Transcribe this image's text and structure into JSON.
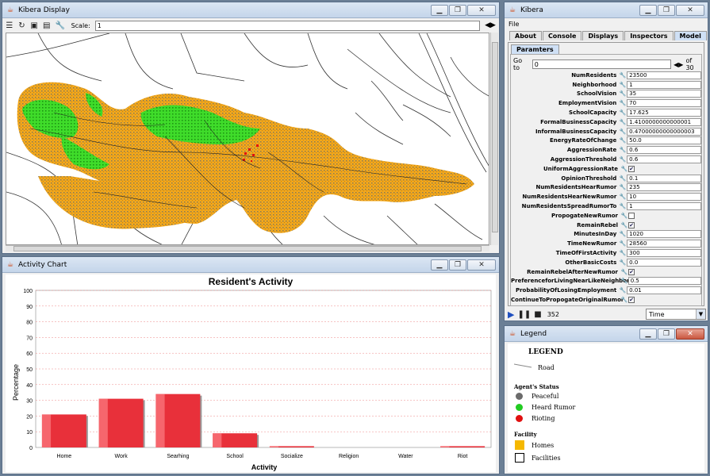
{
  "display_window": {
    "title": "Kibera Display",
    "scale_label": "Scale:",
    "scale_value": "1"
  },
  "chart_window": {
    "title": "Activity Chart"
  },
  "chart_data": {
    "type": "bar",
    "title": "Resident's Activity",
    "xlabel": "Activity",
    "ylabel": "Percentage",
    "categories": [
      "Home",
      "Work",
      "Searhing",
      "School",
      "Socialize",
      "Religion",
      "Water",
      "Riot"
    ],
    "values": [
      21,
      31,
      34,
      9,
      0.8,
      0,
      0,
      0.8
    ],
    "ylim": [
      0,
      100
    ],
    "yticks": [
      "0",
      "10",
      "20",
      "30",
      "40",
      "50",
      "60",
      "70",
      "80",
      "90",
      "100"
    ],
    "grid": true,
    "bar_color": "#e8303a"
  },
  "kibera_window": {
    "title": "Kibera",
    "menu_file": "File",
    "tabs": [
      "About",
      "Console",
      "Displays",
      "Inspectors",
      "Model"
    ],
    "active_tab": "Model",
    "subtab": "Paramters",
    "goto_label": "Go to",
    "goto_value": "0",
    "goto_of": "of 30",
    "params": [
      {
        "label": "NumResidents",
        "value": "23500"
      },
      {
        "label": "Neighborhood",
        "value": "1"
      },
      {
        "label": "SchoolVision",
        "value": "35"
      },
      {
        "label": "EmploymentVision",
        "value": "70"
      },
      {
        "label": "SchoolCapacity",
        "value": "17.625"
      },
      {
        "label": "FormalBusinessCapacity",
        "value": "1.4100000000000001"
      },
      {
        "label": "InformalBusinessCapacity",
        "value": "0.47000000000000003"
      },
      {
        "label": "EnergyRateOfChange",
        "value": "50.0"
      },
      {
        "label": "AggressionRate",
        "value": "0.6"
      },
      {
        "label": "AggressionThreshold",
        "value": "0.6"
      },
      {
        "label": "UniformAggressionRate",
        "check": true
      },
      {
        "label": "OpinionThreshold",
        "value": "0.1"
      },
      {
        "label": "NumResidentsHearRumor",
        "value": "235"
      },
      {
        "label": "NumResidentsHearNewRumor",
        "value": "10"
      },
      {
        "label": "NumResidentsSpreadRumorTo",
        "value": "1"
      },
      {
        "label": "PropogateNewRumor",
        "check": false
      },
      {
        "label": "RemainRebel",
        "check": true
      },
      {
        "label": "MinutesInDay",
        "value": "1020"
      },
      {
        "label": "TimeNewRumor",
        "value": "28560"
      },
      {
        "label": "TimeOfFirstActivity",
        "value": "300"
      },
      {
        "label": "OtherBasicCosts",
        "value": "0.0"
      },
      {
        "label": "RemainRebelAfterNewRumor",
        "check": true
      },
      {
        "label": "PreferenceforLivingNearLikeNeighbors",
        "value": "0.5"
      },
      {
        "label": "ProbabilityOfLosingEmployment",
        "value": "0.01"
      },
      {
        "label": "ContinueToPropogateOriginalRumor",
        "check": true
      }
    ],
    "step_count": "352",
    "time_select": "Time"
  },
  "legend_window": {
    "title": "Legend",
    "legend_title": "LEGEND",
    "road": "Road",
    "agent_status_head": "Agent's Status",
    "peaceful": "Peaceful",
    "heard_rumor": "Heard Rumor",
    "rioting": "Rioting",
    "facility_head": "Facility",
    "homes": "Homes",
    "facilities": "Facilities",
    "colors": {
      "peaceful": "#6b6b6b",
      "heard_rumor": "#22cc22",
      "rioting": "#e01010",
      "homes": "#f5b800"
    }
  }
}
